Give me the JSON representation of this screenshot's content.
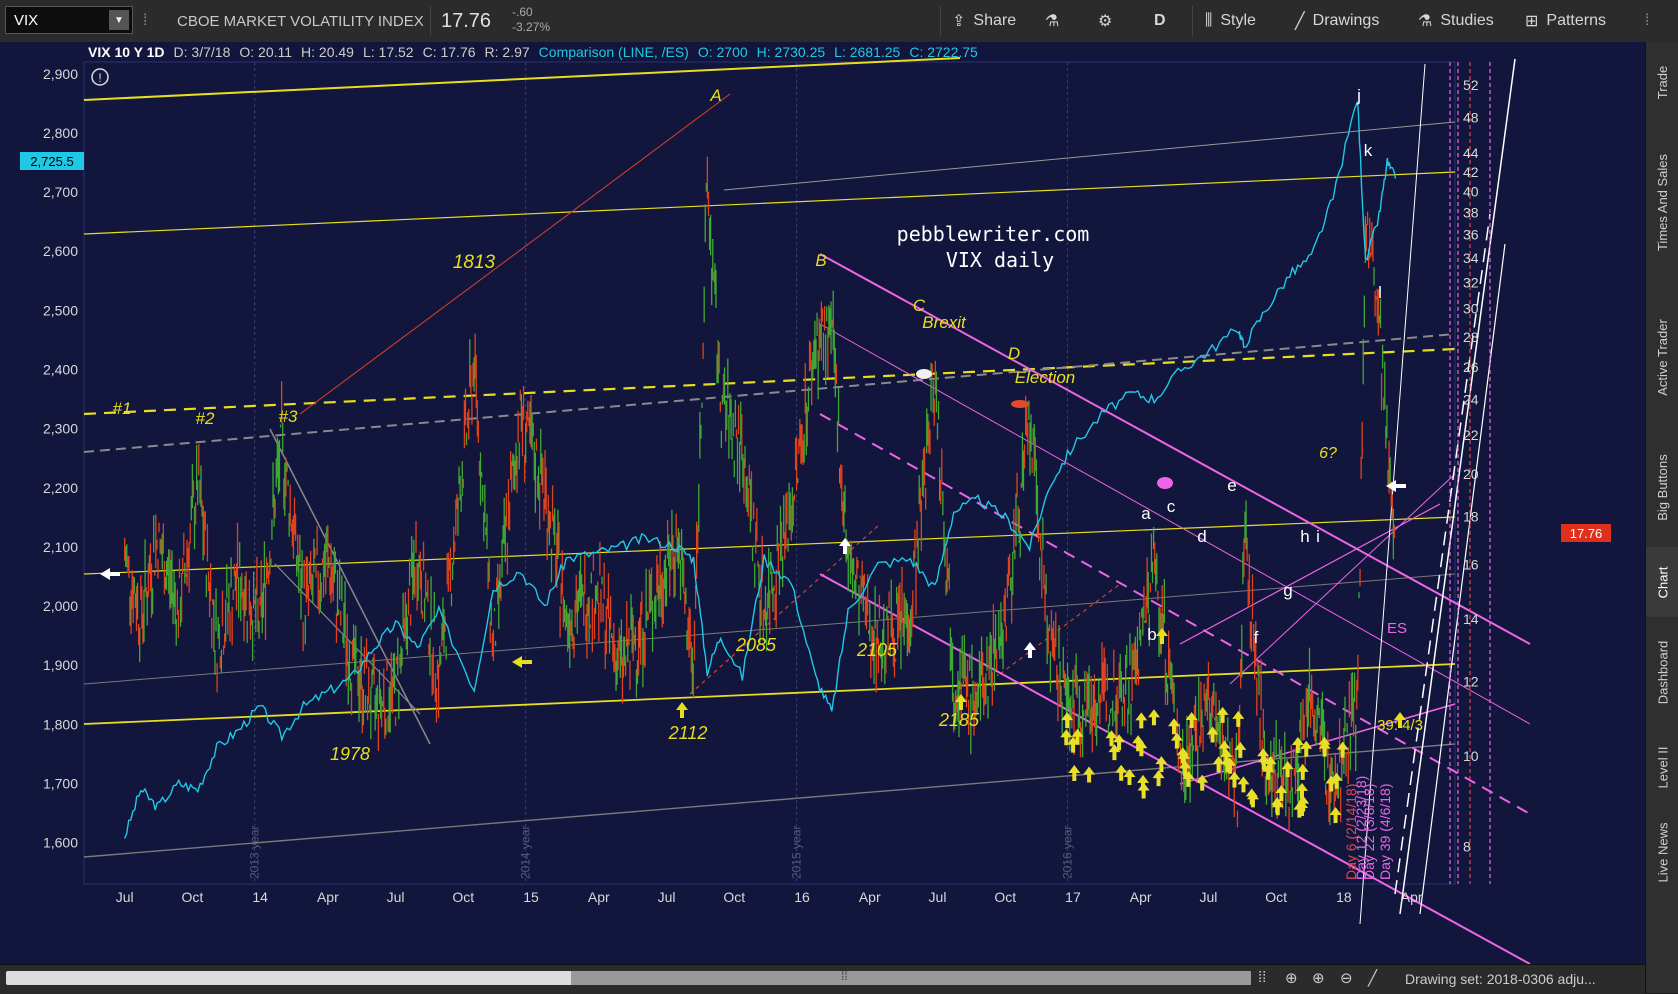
{
  "toolbar": {
    "symbol": "VIX",
    "name": "CBOE MARKET VOLATILITY INDEX",
    "last": "17.76",
    "change": "-.60",
    "change_pct": "-3.27%",
    "share": "Share",
    "period": "D",
    "style": "Style",
    "drawings": "Drawings",
    "studies": "Studies",
    "patterns": "Patterns"
  },
  "info": {
    "title": "VIX 10 Y 1D",
    "date": "D: 3/7/18",
    "open": "O: 20.11",
    "high": "H: 20.49",
    "low": "L: 17.52",
    "close": "C: 17.76",
    "range": "R: 2.97",
    "comparison": "Comparison (LINE, /ES)",
    "cmp_open": "O: 2700",
    "cmp_high": "H: 2730.25",
    "cmp_low": "L: 2681.25",
    "cmp_close": "C: 2722.75"
  },
  "chart_data": {
    "type": "line",
    "title": "pebblewriter.com",
    "subtitle": "VIX daily",
    "left_axis": {
      "label": "/ES",
      "ticks": [
        1600,
        1700,
        1800,
        1900,
        2000,
        2100,
        2200,
        2300,
        2400,
        2500,
        2600,
        2700,
        2800,
        2900
      ],
      "ylim": [
        1530,
        2920
      ]
    },
    "right_axis": {
      "label": "VIX",
      "scale": "log",
      "ticks": [
        8,
        10,
        12,
        14,
        16,
        18,
        20,
        22,
        24,
        26,
        28,
        30,
        32,
        34,
        36,
        38,
        40,
        42,
        44,
        48,
        52
      ],
      "ylim": [
        7.3,
        55
      ]
    },
    "x_ticks": [
      "Jul",
      "Oct",
      "14",
      "Apr",
      "Jul",
      "Oct",
      "15",
      "Apr",
      "Jul",
      "Oct",
      "16",
      "Apr",
      "Jul",
      "Oct",
      "17",
      "Apr",
      "Jul",
      "Oct",
      "18",
      "Apr"
    ],
    "year_markers": [
      "2013 year",
      "2014 year",
      "2015 year",
      "2016 year"
    ],
    "es_marker": "2,725.5",
    "vix_marker": "17.76",
    "series": [
      {
        "name": "VIX",
        "values": [
          [
            2013.5,
            16.3
          ],
          [
            2013.56,
            14.1
          ],
          [
            2013.62,
            17.0
          ],
          [
            2013.7,
            14.3
          ],
          [
            2013.77,
            19.4
          ],
          [
            2013.84,
            13.2
          ],
          [
            2013.92,
            15.5
          ],
          [
            2014.0,
            13.8
          ],
          [
            2014.08,
            21.5
          ],
          [
            2014.16,
            14.5
          ],
          [
            2014.25,
            16.1
          ],
          [
            2014.34,
            12.5
          ],
          [
            2014.42,
            11.3
          ],
          [
            2014.5,
            11.7
          ],
          [
            2014.58,
            16.4
          ],
          [
            2014.66,
            12.1
          ],
          [
            2014.79,
            26.2
          ],
          [
            2014.86,
            13.0
          ],
          [
            2014.96,
            23.0
          ],
          [
            2015.05,
            19.2
          ],
          [
            2015.13,
            14.0
          ],
          [
            2015.24,
            15.1
          ],
          [
            2015.33,
            12.4
          ],
          [
            2015.42,
            13.8
          ],
          [
            2015.54,
            17.0
          ],
          [
            2015.6,
            12.1
          ],
          [
            2015.65,
            40.7
          ],
          [
            2015.7,
            23.8
          ],
          [
            2015.78,
            21.2
          ],
          [
            2015.86,
            14.3
          ],
          [
            2015.96,
            18.2
          ],
          [
            2016.05,
            27.6
          ],
          [
            2016.11,
            28.1
          ],
          [
            2016.17,
            16.0
          ],
          [
            2016.28,
            13.2
          ],
          [
            2016.4,
            14.1
          ],
          [
            2016.49,
            25.8
          ],
          [
            2016.56,
            12.2
          ],
          [
            2016.65,
            11.4
          ],
          [
            2016.75,
            14.0
          ],
          [
            2016.84,
            22.5
          ],
          [
            2016.92,
            12.7
          ],
          [
            2017.0,
            11.3
          ],
          [
            2017.12,
            11.5
          ],
          [
            2017.22,
            12.0
          ],
          [
            2017.3,
            15.9
          ],
          [
            2017.4,
            9.8
          ],
          [
            2017.5,
            11.2
          ],
          [
            2017.61,
            9.4
          ],
          [
            2017.63,
            17.3
          ],
          [
            2017.71,
            9.8
          ],
          [
            2017.8,
            9.3
          ],
          [
            2017.88,
            11.5
          ],
          [
            2017.96,
            9.1
          ],
          [
            2018.05,
            11.3
          ],
          [
            2018.08,
            37.3
          ],
          [
            2018.13,
            28.5
          ],
          [
            2018.16,
            20.3
          ],
          [
            2018.19,
            17.8
          ]
        ]
      },
      {
        "name": "/ES",
        "values": [
          [
            2013.5,
            1610
          ],
          [
            2013.56,
            1690
          ],
          [
            2013.62,
            1660
          ],
          [
            2013.7,
            1700
          ],
          [
            2013.77,
            1690
          ],
          [
            2013.84,
            1760
          ],
          [
            2013.92,
            1790
          ],
          [
            2014.0,
            1830
          ],
          [
            2014.08,
            1780
          ],
          [
            2014.16,
            1830
          ],
          [
            2014.25,
            1855
          ],
          [
            2014.34,
            1880
          ],
          [
            2014.42,
            1930
          ],
          [
            2014.5,
            1970
          ],
          [
            2014.58,
            1930
          ],
          [
            2014.66,
            1990
          ],
          [
            2014.79,
            1860
          ],
          [
            2014.86,
            2030
          ],
          [
            2014.96,
            2060
          ],
          [
            2015.05,
            2000
          ],
          [
            2015.13,
            2080
          ],
          [
            2015.24,
            2090
          ],
          [
            2015.33,
            2100
          ],
          [
            2015.42,
            2115
          ],
          [
            2015.54,
            2100
          ],
          [
            2015.6,
            2080
          ],
          [
            2015.65,
            1890
          ],
          [
            2015.7,
            1950
          ],
          [
            2015.78,
            1880
          ],
          [
            2015.86,
            2080
          ],
          [
            2015.96,
            2040
          ],
          [
            2016.05,
            1880
          ],
          [
            2016.11,
            1820
          ],
          [
            2016.17,
            1990
          ],
          [
            2016.28,
            2070
          ],
          [
            2016.4,
            2080
          ],
          [
            2016.49,
            2030
          ],
          [
            2016.56,
            2160
          ],
          [
            2016.65,
            2180
          ],
          [
            2016.75,
            2150
          ],
          [
            2016.84,
            2100
          ],
          [
            2016.92,
            2210
          ],
          [
            2017.0,
            2270
          ],
          [
            2017.12,
            2330
          ],
          [
            2017.22,
            2360
          ],
          [
            2017.3,
            2350
          ],
          [
            2017.4,
            2400
          ],
          [
            2017.5,
            2430
          ],
          [
            2017.61,
            2470
          ],
          [
            2017.63,
            2440
          ],
          [
            2017.71,
            2500
          ],
          [
            2017.8,
            2560
          ],
          [
            2017.88,
            2590
          ],
          [
            2017.96,
            2690
          ],
          [
            2018.05,
            2860
          ],
          [
            2018.08,
            2580
          ],
          [
            2018.13,
            2660
          ],
          [
            2018.16,
            2750
          ],
          [
            2018.19,
            2723
          ]
        ]
      }
    ],
    "annotations": [
      "#1",
      "#2",
      "#3",
      "1813",
      "1978",
      "A",
      "2112",
      "2085",
      "B",
      "2105",
      "C",
      "Brexit",
      "D",
      "Election",
      "2185",
      "a",
      "b",
      "c",
      "d",
      "e",
      "f",
      "g",
      "h",
      "i",
      "j",
      "k",
      "l",
      "6?",
      "39: 4/3",
      "ES"
    ],
    "labels": [
      "Day 6 (2/14/18)",
      "Day 12 (2/23/18)",
      "Day 22 (3/8/18)",
      "Day 39 (4/6/18)"
    ]
  },
  "right_tabs": [
    "Trade",
    "Times And Sales",
    "Active Trader",
    "Big Buttons",
    "Chart",
    "Dashboard",
    "Level II",
    "Live News"
  ],
  "bottom": {
    "drawing_set": "Drawing set: 2018-0306 adju..."
  },
  "colors": {
    "background": "#12153c",
    "es_line": "#21c8e6",
    "up_bar": "#3fa934",
    "down_bar": "#e0421c",
    "trend_yellow": "#e8df1c",
    "trend_magenta": "#ee66e6"
  }
}
